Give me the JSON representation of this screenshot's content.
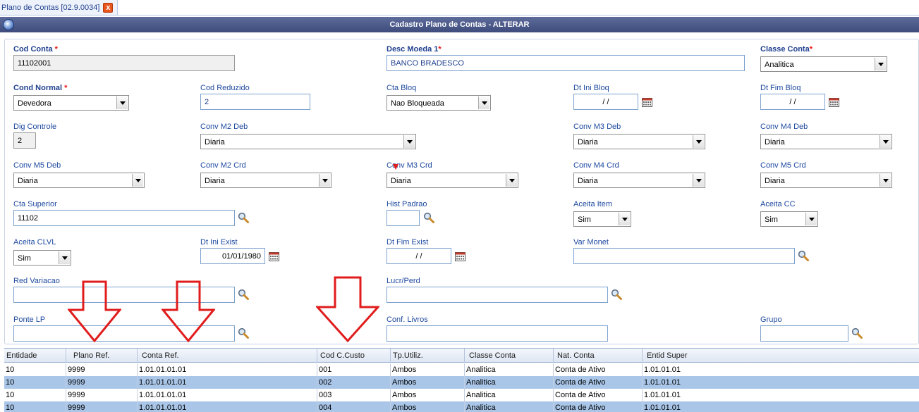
{
  "tab": {
    "label": "Plano de Contas [02.9.0034]",
    "close": "x"
  },
  "titlebar": {
    "title": "Cadastro Plano de Contas - ALTERAR"
  },
  "form": {
    "cod_conta": {
      "label": "Cod Conta",
      "value": "11102001"
    },
    "desc_moeda": {
      "label": "Desc Moeda 1",
      "value": "BANCO BRADESCO"
    },
    "classe_conta": {
      "label": "Classe Conta",
      "value": "Analitica"
    },
    "cond_normal": {
      "label": "Cond Normal",
      "value": "Devedora"
    },
    "cod_reduzido": {
      "label": "Cod Reduzido",
      "value": "2"
    },
    "cta_bloq": {
      "label": "Cta Bloq",
      "value": "Nao Bloqueada"
    },
    "dt_ini_bloq": {
      "label": "Dt Ini Bloq",
      "value": "/ /"
    },
    "dt_fim_bloq": {
      "label": "Dt Fim Bloq",
      "value": "/ /"
    },
    "dig_controle": {
      "label": "Dig Controle",
      "value": "2"
    },
    "conv_m2_deb": {
      "label": "Conv M2 Deb",
      "value": "Diaria"
    },
    "conv_m3_deb": {
      "label": "Conv M3 Deb",
      "value": "Diaria"
    },
    "conv_m4_deb": {
      "label": "Conv M4 Deb",
      "value": "Diaria"
    },
    "conv_m5_deb": {
      "label": "Conv M5 Deb",
      "value": "Diaria"
    },
    "conv_m2_crd": {
      "label": "Conv M2 Crd",
      "value": "Diaria"
    },
    "conv_m3_crd": {
      "label": "Conv M3 Crd",
      "value": "Diaria"
    },
    "conv_m4_crd": {
      "label": "Conv M4 Crd",
      "value": "Diaria"
    },
    "conv_m5_crd": {
      "label": "Conv M5 Crd",
      "value": "Diaria"
    },
    "cta_superior": {
      "label": "Cta Superior",
      "value": "11102"
    },
    "hist_padrao": {
      "label": "Hist Padrao",
      "value": ""
    },
    "aceita_item": {
      "label": "Aceita Item",
      "value": "Sim"
    },
    "aceita_cc": {
      "label": "Aceita CC",
      "value": "Sim"
    },
    "aceita_clvl": {
      "label": "Aceita CLVL",
      "value": "Sim"
    },
    "dt_ini_exist": {
      "label": "Dt Ini Exist",
      "value": "01/01/1980"
    },
    "dt_fim_exist": {
      "label": "Dt Fim Exist",
      "value": "/ /"
    },
    "var_monet": {
      "label": "Var Monet",
      "value": ""
    },
    "red_variacao": {
      "label": "Red Variacao",
      "value": ""
    },
    "lucr_perd": {
      "label": "Lucr/Perd",
      "value": ""
    },
    "ponte_lp": {
      "label": "Ponte LP",
      "value": ""
    },
    "conf_livros": {
      "label": "Conf. Livros",
      "value": ""
    },
    "grupo": {
      "label": "Grupo",
      "value": ""
    }
  },
  "grid": {
    "headers": [
      "Entidade",
      "Plano Ref.",
      "Conta Ref.",
      "Cod C.Custo",
      "Tp.Utiliz.",
      "Classe Conta",
      "Nat. Conta",
      "Entid Super"
    ],
    "rows": [
      [
        "10",
        "9999",
        "1.01.01.01.01",
        "001",
        "Ambos",
        "Analitica",
        "Conta de Ativo",
        "1.01.01.01"
      ],
      [
        "10",
        "9999",
        "1.01.01.01.01",
        "002",
        "Ambos",
        "Analitica",
        "Conta de Ativo",
        "1.01.01.01"
      ],
      [
        "10",
        "9999",
        "1.01.01.01.01",
        "003",
        "Ambos",
        "Analitica",
        "Conta de Ativo",
        "1.01.01.01"
      ],
      [
        "10",
        "9999",
        "1.01.01.01.01",
        "004",
        "Ambos",
        "Analitica",
        "Conta de Ativo",
        "1.01.01.01"
      ]
    ]
  },
  "colors": {
    "title_bar": "#44528a",
    "label": "#1f4aa0",
    "required": "#e11111",
    "selected_row": "#a9c6e8",
    "annotation_arrow": "#e01c1c"
  },
  "icons": {
    "lookup": "magnifier-icon",
    "calendar": "calendar-icon",
    "dropdown": "chevron-down-icon"
  }
}
